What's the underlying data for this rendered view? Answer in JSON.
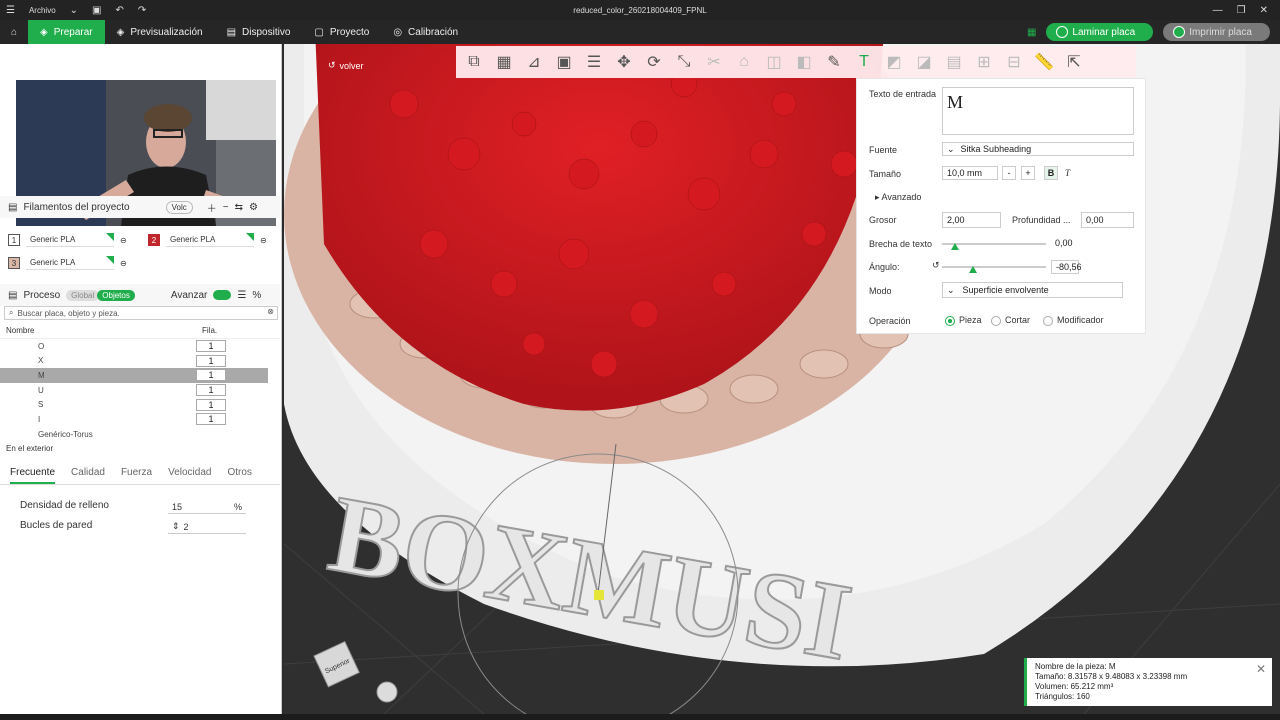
{
  "titlebar": {
    "menu_label": "Archivo",
    "title": "reduced_color_260218004409_FPNL"
  },
  "toolbar": {
    "tabs": [
      {
        "label": "Preparar",
        "active": true
      },
      {
        "label": "Previsualización"
      },
      {
        "label": "Dispositivo"
      },
      {
        "label": "Proyecto"
      },
      {
        "label": "Calibración"
      }
    ],
    "slice_label": "Laminar placa",
    "print_label": "Imprimir placa"
  },
  "filaments": {
    "title": "Filamentos del proyecto",
    "volc_label": "Volc",
    "items": [
      {
        "num": "1",
        "name": "Generic PLA",
        "color": "#ffffff"
      },
      {
        "num": "2",
        "name": "Generic PLA",
        "color": "#c0272d"
      },
      {
        "num": "3",
        "name": "Generic PLA",
        "color": "#dbb7a8"
      }
    ]
  },
  "process": {
    "title": "Proceso",
    "global_label": "Global",
    "objects_label": "Objetos",
    "advanced_label": "Avanzar",
    "search_placeholder": "Buscar placa, objeto y pieza.",
    "col_name": "Nombre",
    "col_fila": "Fila.",
    "rows": [
      {
        "name": "O",
        "fila": "1"
      },
      {
        "name": "X",
        "fila": "1"
      },
      {
        "name": "M",
        "fila": "1",
        "selected": true
      },
      {
        "name": "U",
        "fila": "1"
      },
      {
        "name": "S",
        "fila": "1"
      },
      {
        "name": "I",
        "fila": "1"
      }
    ],
    "torus_label": "Genérico-Torus",
    "exterior_label": "En el exterior"
  },
  "settings_tabs": [
    "Frecuente",
    "Calidad",
    "Fuerza",
    "Velocidad",
    "Otros"
  ],
  "params": {
    "infill_label": "Densidad de relleno",
    "infill_value": "15",
    "infill_unit": "%",
    "walls_label": "Bucles de pared",
    "walls_value": "2"
  },
  "viewport": {
    "back_label": "volver",
    "text_3d": "BOXMUSI",
    "view_cube_label": "Superior"
  },
  "text_panel": {
    "input_label": "Texto de entrada",
    "input_value": "M",
    "font_label": "Fuente",
    "font_value": "Sitka Subheading",
    "size_label": "Tamaño",
    "size_value": "10,0 mm",
    "advanced_label": "Avanzado",
    "thickness_label": "Grosor",
    "thickness_value": "2,00",
    "depth_label": "Profundidad ...",
    "depth_value": "0,00",
    "gap_label": "Brecha de texto",
    "gap_value": "0,00",
    "angle_label": "Ángulo:",
    "angle_value": "-80,56",
    "mode_label": "Modo",
    "mode_value": "Superficie envolvente",
    "operation_label": "Operación",
    "op_piece": "Pieza",
    "op_cut": "Cortar",
    "op_modifier": "Modificador"
  },
  "info": {
    "name": "Nombre de la pieza: M",
    "size": "Tamaño: 8.31578 x 9.48083 x 3.23398 mm",
    "volume": "Volumen: 65.212 mm³",
    "triangles": "Triángulos: 160"
  }
}
